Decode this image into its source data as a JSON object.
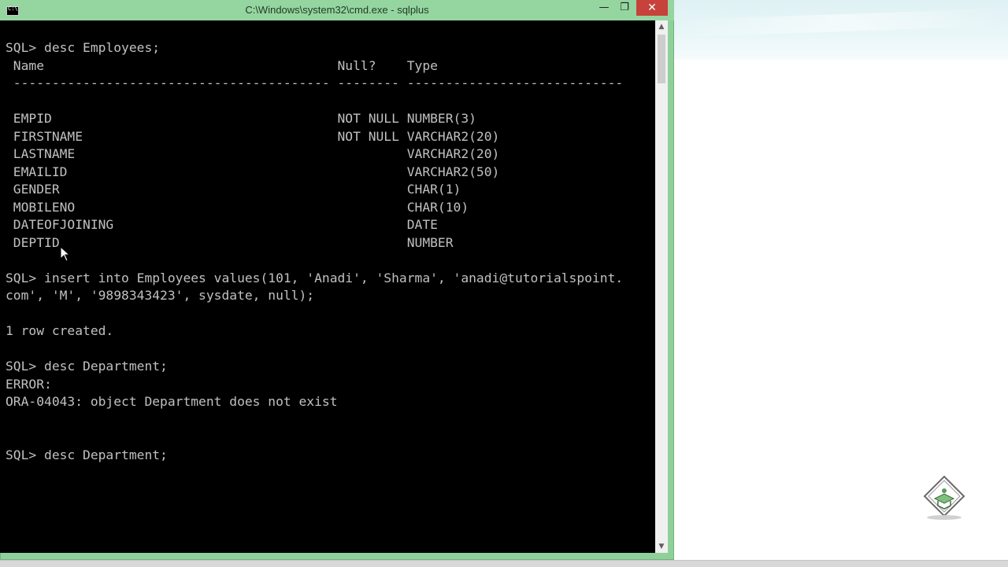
{
  "window": {
    "title": "C:\\Windows\\system32\\cmd.exe - sqlplus",
    "minimize_glyph": "—",
    "restore_glyph": "❐",
    "close_glyph": "✕"
  },
  "console": {
    "lines": [
      "SQL> desc Employees;",
      " Name                                      Null?    Type",
      " ----------------------------------------- -------- ----------------------------",
      "",
      " EMPID                                     NOT NULL NUMBER(3)",
      " FIRSTNAME                                 NOT NULL VARCHAR2(20)",
      " LASTNAME                                           VARCHAR2(20)",
      " EMAILID                                            VARCHAR2(50)",
      " GENDER                                             CHAR(1)",
      " MOBILENO                                           CHAR(10)",
      " DATEOFJOINING                                      DATE",
      " DEPTID                                             NUMBER",
      "",
      "SQL> insert into Employees values(101, 'Anadi', 'Sharma', 'anadi@tutorialspoint.",
      "com', 'M', '9898343423', sysdate, null);",
      "",
      "1 row created.",
      "",
      "SQL> desc Department;",
      "ERROR:",
      "ORA-04043: object Department does not exist",
      "",
      "",
      "SQL> desc Department;"
    ]
  },
  "colors": {
    "frame": "#8fd09a",
    "console_bg": "#000000",
    "console_text": "#c0c0c0",
    "close_button": "#c7423a"
  },
  "icons": {
    "window_icon": "cmd-icon",
    "logo": "tutorialspoint-logo-icon",
    "pointer": "mouse-pointer-icon"
  }
}
